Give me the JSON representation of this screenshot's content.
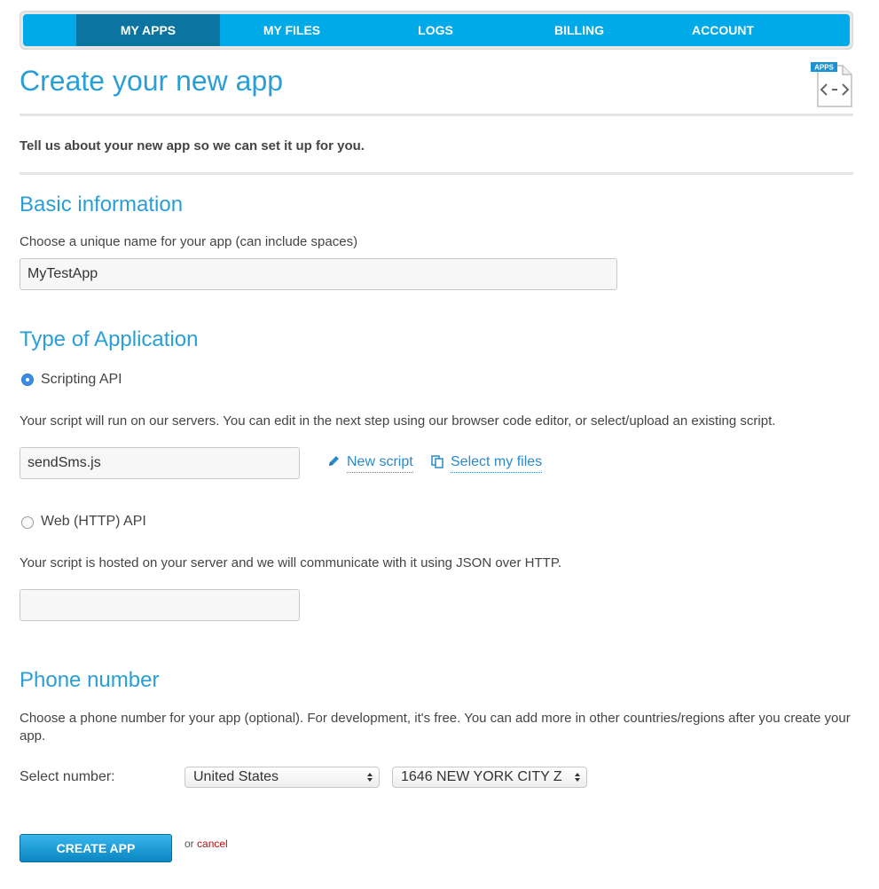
{
  "nav": {
    "items": [
      {
        "label": "MY APPS",
        "active": true
      },
      {
        "label": "MY FILES",
        "active": false
      },
      {
        "label": "LOGS",
        "active": false
      },
      {
        "label": "BILLING",
        "active": false
      },
      {
        "label": "ACCOUNT",
        "active": false
      }
    ]
  },
  "page": {
    "title": "Create your new app",
    "icon_badge": "APPS",
    "intro": "Tell us about your new app so we can set it up for you."
  },
  "basic": {
    "heading": "Basic information",
    "name_label": "Choose a unique name for your app (can include spaces)",
    "name_value": "MyTestApp"
  },
  "type": {
    "heading": "Type of Application",
    "scripting": {
      "label": "Scripting API",
      "checked": true,
      "description": "Your script will run on our servers. You can edit in the next step using our browser code editor, or select/upload an existing script.",
      "script_value": "sendSms.js",
      "new_script_label": "New script",
      "select_files_label": "Select my files"
    },
    "web": {
      "label": "Web (HTTP) API",
      "checked": false,
      "description": "Your script is hosted on your server and we will communicate with it using JSON over HTTP.",
      "url_value": ""
    }
  },
  "phone": {
    "heading": "Phone number",
    "description": "Choose a phone number for your app (optional). For development, it's free. You can add more in other countries/regions after you create your app.",
    "select_label": "Select number:",
    "country_value": "United States",
    "number_value": "1646 NEW YORK CITY Z"
  },
  "actions": {
    "create_label": "CREATE APP",
    "or_text": "or",
    "cancel_label": "cancel"
  },
  "colors": {
    "accent": "#2a9fd6",
    "nav_bg": "#00a9e8",
    "nav_active": "#0b74a1",
    "cancel": "#b11111"
  },
  "icons": {
    "apps": "apps-code-icon",
    "new_script": "pencil-icon",
    "select_files": "copy-files-icon",
    "select_arrows": "up-down-arrows-icon"
  }
}
